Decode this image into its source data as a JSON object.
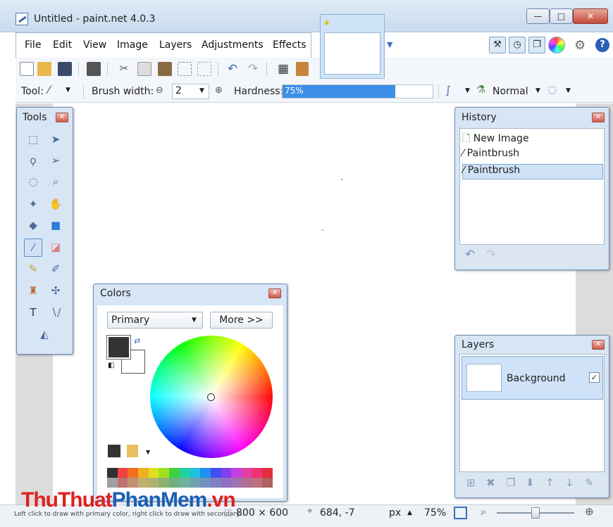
{
  "window": {
    "title": "Untitled - paint.net 4.0.3",
    "min": "—",
    "max": "□",
    "close": "✕"
  },
  "menu": [
    "File",
    "Edit",
    "View",
    "Image",
    "Layers",
    "Adjustments",
    "Effects"
  ],
  "tool_options": {
    "tool_label": "Tool:",
    "brush_width_label": "Brush width:",
    "brush_width_value": "2",
    "hardness_label": "Hardness:",
    "hardness_value": "75%",
    "hardness_fraction": 0.75,
    "blend_mode": "Normal"
  },
  "panels": {
    "tools": {
      "title": "Tools"
    },
    "history": {
      "title": "History",
      "items": [
        "New Image",
        "Paintbrush",
        "Paintbrush"
      ],
      "selected_index": 2
    },
    "colors": {
      "title": "Colors",
      "mode": "Primary",
      "more_button": "More >>",
      "primary_color": "#333333",
      "secondary_color": "#ffffff"
    },
    "layers": {
      "title": "Layers",
      "items": [
        {
          "name": "Background",
          "visible": true
        }
      ]
    }
  },
  "status": {
    "hint": "Left click to draw with primary color, right click to draw with secondary...",
    "image_size": "800 × 600",
    "cursor_pos": "684, -7",
    "units": "px",
    "zoom": "75%"
  },
  "watermark": {
    "part1": "ThuThuat",
    "part2": "PhanMem",
    "part3": ".vn"
  },
  "palette": [
    "#303030",
    "#f04040",
    "#f07020",
    "#f0b020",
    "#e0e020",
    "#a0e020",
    "#40d040",
    "#20d0a0",
    "#20c0e0",
    "#2090f0",
    "#4050f0",
    "#8040f0",
    "#c040e0",
    "#e040a0",
    "#f03070",
    "#e03040",
    "#a0a0a0",
    "#c07070",
    "#c09070",
    "#c0b070",
    "#b0b070",
    "#90b070",
    "#70b080",
    "#70b0a0",
    "#70a0b0",
    "#7090c0",
    "#8080c0",
    "#9070c0",
    "#a070b0",
    "#b07090",
    "#c07080",
    "#b06060"
  ]
}
